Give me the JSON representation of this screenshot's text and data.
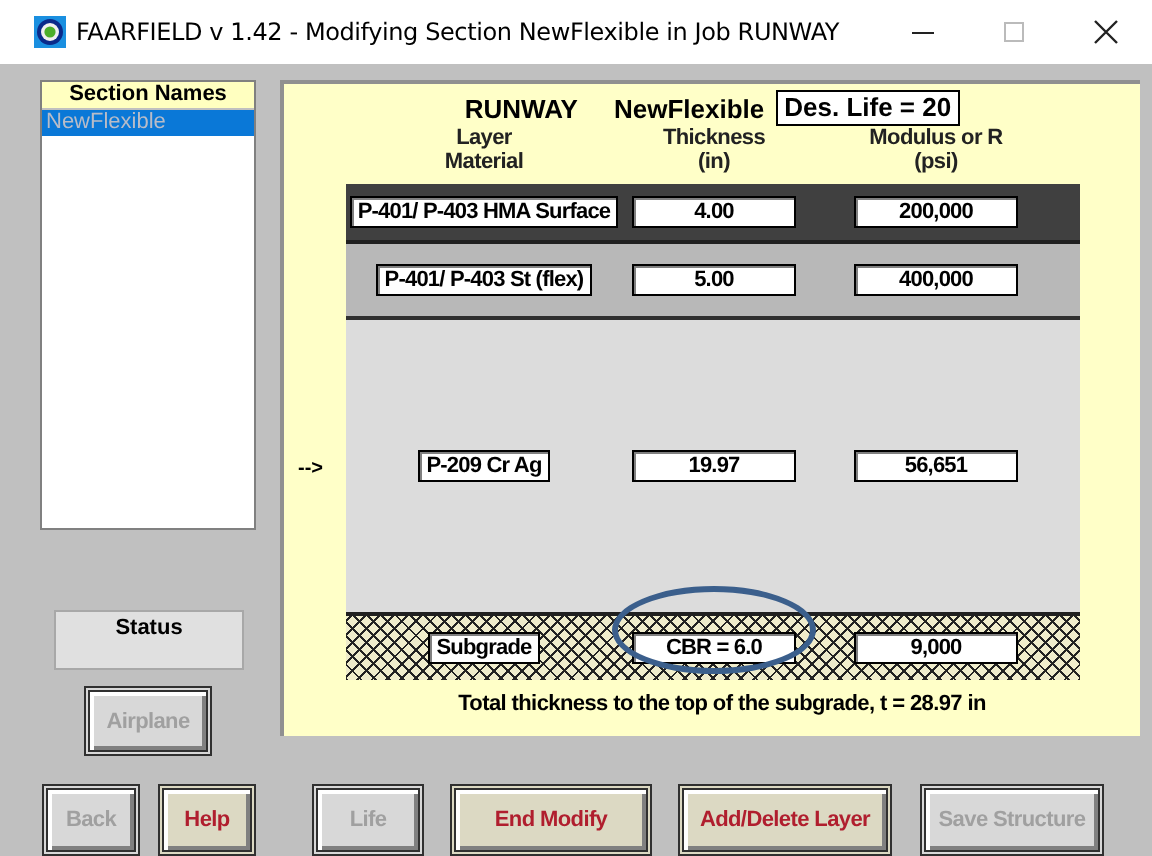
{
  "window": {
    "title": "FAARFIELD v 1.42 - Modifying Section NewFlexible in Job RUNWAY"
  },
  "sections": {
    "header": "Section Names",
    "items": [
      {
        "name": "NewFlexible",
        "selected": true
      }
    ]
  },
  "status": {
    "label": "Status"
  },
  "section_header": {
    "job": "RUNWAY",
    "section": "NewFlexible",
    "design_life": "Des. Life = 20"
  },
  "columns": [
    {
      "lines": [
        "Layer",
        "Material"
      ]
    },
    {
      "lines": [
        "Thickness",
        "(in)"
      ]
    },
    {
      "lines": [
        "Modulus or R",
        "(psi)"
      ]
    }
  ],
  "current_layer_marker": "-->",
  "layers": [
    {
      "kind": "surface",
      "material": "P-401/ P-403 HMA Surface",
      "thickness": "4.00",
      "modulus": "200,000",
      "selected": false,
      "circled": false
    },
    {
      "kind": "base",
      "material": "P-401/ P-403 St (flex)",
      "thickness": "5.00",
      "modulus": "400,000",
      "selected": false,
      "circled": false
    },
    {
      "kind": "subbase",
      "material": "P-209 Cr Ag",
      "thickness": "19.97",
      "modulus": "56,651",
      "selected": true,
      "circled": false
    },
    {
      "kind": "subgrade",
      "material": "Subgrade",
      "thickness": "CBR = 6.0",
      "modulus": "9,000",
      "selected": false,
      "circled": true
    }
  ],
  "total_thickness": "Total thickness to the top of the subgrade, t = 28.97 in",
  "side_button": {
    "label": "Airplane",
    "disabled": true
  },
  "buttons": [
    {
      "label": "Back",
      "disabled": true
    },
    {
      "label": "Help",
      "disabled": false
    },
    {
      "label": "Life",
      "disabled": true
    },
    {
      "label": "End Modify",
      "disabled": false
    },
    {
      "label": "Add/Delete Layer",
      "disabled": false
    },
    {
      "label": "Save Structure",
      "disabled": true
    }
  ]
}
